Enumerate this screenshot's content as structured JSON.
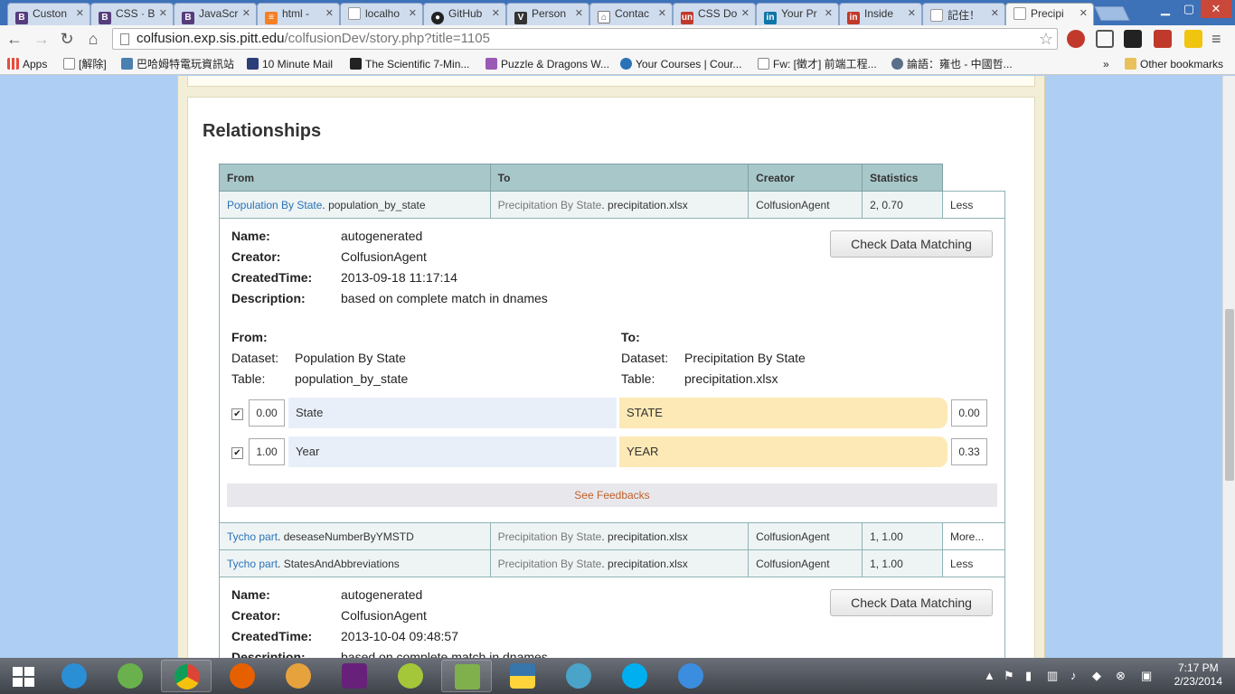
{
  "browser": {
    "tabs": [
      {
        "label": "Custon",
        "icon": "bootstrap-icon",
        "color": "#563d7c"
      },
      {
        "label": "CSS · B",
        "icon": "bootstrap-icon",
        "color": "#563d7c"
      },
      {
        "label": "JavaScr",
        "icon": "bootstrap-icon",
        "color": "#563d7c"
      },
      {
        "label": "html -",
        "icon": "stackoverflow-icon",
        "color": "#f48024"
      },
      {
        "label": "localho",
        "icon": "page-icon",
        "color": "#999999"
      },
      {
        "label": "GitHub",
        "icon": "github-icon",
        "color": "#222222"
      },
      {
        "label": "Person",
        "icon": "v-icon",
        "color": "#333333"
      },
      {
        "label": "Contac",
        "icon": "house-icon",
        "color": "#777777"
      },
      {
        "label": "CSS Do",
        "icon": "un-icon",
        "color": "#c0392b"
      },
      {
        "label": "Your Pr",
        "icon": "linkedin-icon",
        "color": "#0e76a8"
      },
      {
        "label": "Inside",
        "icon": "inside-icon",
        "color": "#c0392b"
      },
      {
        "label": "記住！",
        "icon": "page-icon",
        "color": "#999999"
      },
      {
        "label": "Precipi",
        "icon": "page-icon",
        "color": "#999999"
      }
    ],
    "url_host": "colfusion.exp.sis.pitt.edu",
    "url_path": "/colfusionDev/story.php?title=1105",
    "bookmarks": [
      {
        "label": "Apps",
        "icon": "apps-icon"
      },
      {
        "label": "[解除]",
        "icon": "page-icon"
      },
      {
        "label": "巴哈姆特電玩資訊站",
        "icon": "bahamut-icon"
      },
      {
        "label": "10 Minute Mail",
        "icon": "mail-icon"
      },
      {
        "label": "The Scientific 7-Min...",
        "icon": "nyt-icon"
      },
      {
        "label": "Puzzle & Dragons W...",
        "icon": "puzzle-icon"
      },
      {
        "label": "Your Courses | Cour...",
        "icon": "coursera-icon"
      },
      {
        "label": "Fw: [徵才] 前端工程...",
        "icon": "page-icon"
      },
      {
        "label": "論語：雍也 - 中國哲...",
        "icon": "globe-icon"
      }
    ],
    "bookmarks_overflow": "»",
    "other_bookmarks": "Other bookmarks"
  },
  "page": {
    "heading": "Relationships",
    "table_headers": {
      "from": "From",
      "to": "To",
      "creator": "Creator",
      "statistics": "Statistics"
    },
    "rows": [
      {
        "from_link": "Population By State",
        "from_table": "population_by_state",
        "to_dataset": "Precipitation By State",
        "to_table": "precipitation.xlsx",
        "creator": "ColfusionAgent",
        "statistics": "2, 0.70",
        "toggle": "Less"
      },
      {
        "from_link": "Tycho part",
        "from_table": "deseaseNumberByYMSTD",
        "to_dataset": "Precipitation By State",
        "to_table": "precipitation.xlsx",
        "creator": "ColfusionAgent",
        "statistics": "1, 1.00",
        "toggle": "More..."
      },
      {
        "from_link": "Tycho part",
        "from_table": "StatesAndAbbreviations",
        "to_dataset": "Precipitation By State",
        "to_table": "precipitation.xlsx",
        "creator": "ColfusionAgent",
        "statistics": "1, 1.00",
        "toggle": "Less"
      }
    ],
    "detail_labels": {
      "name": "Name:",
      "creator": "Creator:",
      "created_time": "CreatedTime:",
      "description": "Description:",
      "from": "From:",
      "to": "To:",
      "dataset": "Dataset:",
      "table": "Table:"
    },
    "detail1": {
      "name": "autogenerated",
      "creator": "ColfusionAgent",
      "created_time": "2013-09-18 11:17:14",
      "description": "based on complete match in dnames",
      "button": "Check Data Matching",
      "from_dataset": "Population By State",
      "from_table": "population_by_state",
      "to_dataset": "Precipitation By State",
      "to_table": "precipitation.xlsx",
      "columns": [
        {
          "checked": true,
          "left_score": "0.00",
          "from_col": "State",
          "to_col": "STATE",
          "right_score": "0.00"
        },
        {
          "checked": true,
          "left_score": "1.00",
          "from_col": "Year",
          "to_col": "YEAR",
          "right_score": "0.33"
        }
      ],
      "feedback_link": "See Feedbacks"
    },
    "detail2": {
      "name": "autogenerated",
      "creator": "ColfusionAgent",
      "created_time": "2013-10-04 09:48:57",
      "description": "based on complete match in dnames",
      "button": "Check Data Matching"
    }
  },
  "taskbar": {
    "apps": [
      "ie-icon",
      "clover-icon",
      "chrome-icon",
      "firefox-icon",
      "eclipse-icon",
      "visual-studio-icon",
      "android-icon",
      "notepad-icon",
      "python-icon",
      "network-icon",
      "skype-icon",
      "itunes-icon"
    ],
    "time": "7:17 PM",
    "date": "2/23/2014"
  }
}
